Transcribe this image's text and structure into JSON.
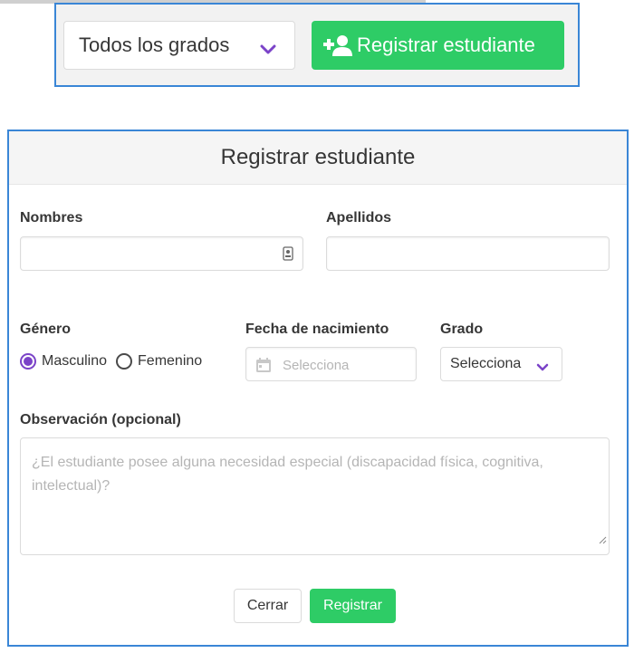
{
  "toolbar": {
    "grade_filter": {
      "value": "Todos los grados",
      "icon": "chevron-down-icon"
    },
    "register_button": {
      "label": "Registrar estudiante",
      "icon": "user-plus-icon"
    }
  },
  "modal": {
    "title": "Registrar estudiante",
    "fields": {
      "first_name": {
        "label": "Nombres",
        "value": ""
      },
      "last_name": {
        "label": "Apellidos",
        "value": ""
      },
      "gender": {
        "label": "Género",
        "options": [
          "Masculino",
          "Femenino"
        ],
        "selected": "Masculino"
      },
      "birth_date": {
        "label": "Fecha de nacimiento",
        "placeholder": "Selecciona"
      },
      "grade": {
        "label": "Grado",
        "value": "Selecciona"
      },
      "observation": {
        "label": "Observación (opcional)",
        "placeholder": "¿El estudiante posee alguna necesidad especial (discapacidad física, cognitiva, intelectual)?"
      }
    },
    "buttons": {
      "close": "Cerrar",
      "submit": "Registrar"
    }
  },
  "colors": {
    "accent": "#7b43c8",
    "success": "#2ecc66",
    "frame": "#3a86d6"
  }
}
